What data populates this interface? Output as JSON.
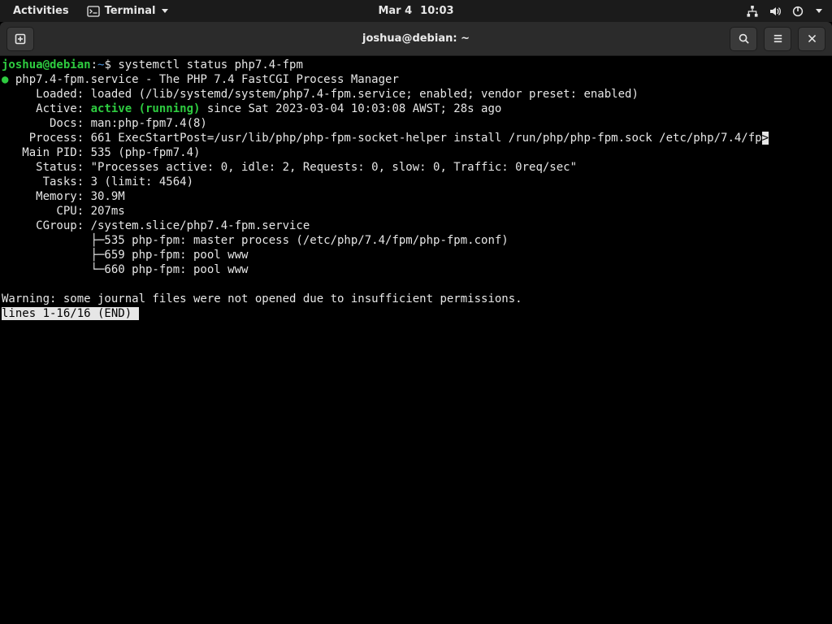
{
  "topbar": {
    "activities": "Activities",
    "app_label": "Terminal",
    "date": "Mar 4",
    "time": "10:03"
  },
  "titlebar": {
    "title": "joshua@debian: ~"
  },
  "prompt": {
    "user_host": "joshua@debian",
    "colon": ":",
    "path": "~",
    "dollar": "$ ",
    "command": "systemctl status php7.4-fpm"
  },
  "output": {
    "dot": "●",
    "service_name": " php7.4-fpm.service - The PHP 7.4 FastCGI Process Manager",
    "loaded": "     Loaded: loaded (/lib/systemd/system/php7.4-fpm.service; enabled; vendor preset: enabled)",
    "active_label": "     Active: ",
    "active_value": "active (running)",
    "active_rest": " since Sat 2023-03-04 10:03:08 AWST; 28s ago",
    "docs": "       Docs: man:php-fpm7.4(8)",
    "process": "    Process: 661 ExecStartPost=/usr/lib/php/php-fpm-socket-helper install /run/php/php-fpm.sock /etc/php/7.4/fp",
    "overflow": ">",
    "mainpid": "   Main PID: 535 (php-fpm7.4)",
    "status": "     Status: \"Processes active: 0, idle: 2, Requests: 0, slow: 0, Traffic: 0req/sec\"",
    "tasks": "      Tasks: 3 (limit: 4564)",
    "memory": "     Memory: 30.9M",
    "cpu": "        CPU: 207ms",
    "cgroup": "     CGroup: /system.slice/php7.4-fpm.service",
    "cg1": "             ├─535 php-fpm: master process (/etc/php/7.4/fpm/php-fpm.conf)",
    "cg2": "             ├─659 php-fpm: pool www",
    "cg3": "             └─660 php-fpm: pool www",
    "blank": "",
    "warning": "Warning: some journal files were not opened due to insufficient permissions.",
    "pager": "lines 1-16/16 (END)"
  }
}
